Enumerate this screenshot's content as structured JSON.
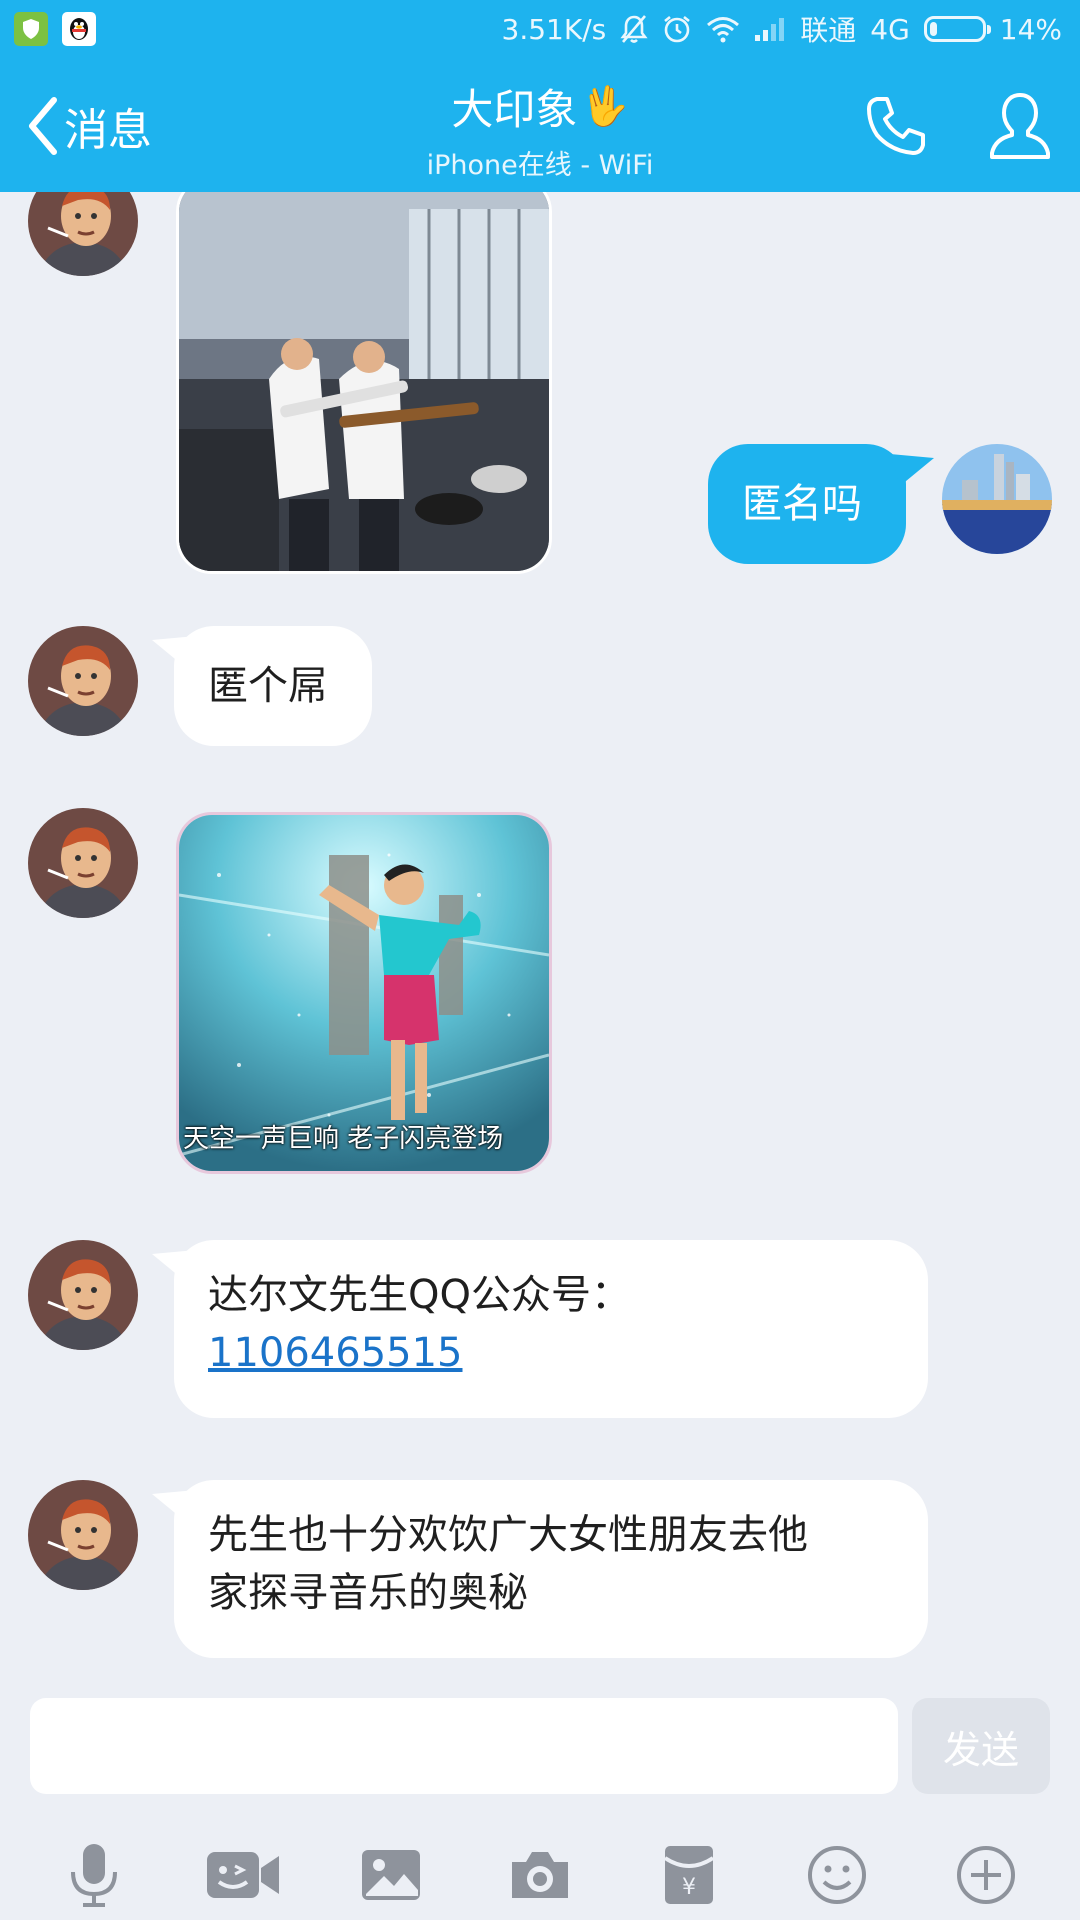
{
  "status_bar": {
    "network_speed": "3.51K/s",
    "carrier": "联通",
    "network_type": "4G",
    "battery": "14%",
    "battery_level": 0.14,
    "app_icons": [
      "shield-icon",
      "qq-penguin-icon"
    ],
    "status_icons": [
      "mute-bell-icon",
      "alarm-clock-icon",
      "wifi-icon",
      "signal-icon",
      "battery-icon"
    ]
  },
  "nav": {
    "back_label": "消息",
    "title": "大印象",
    "title_emoji": "🖖",
    "subtitle": "iPhone在线 - WiFi",
    "icons": [
      "back-chevron-icon",
      "phone-icon",
      "profile-icon"
    ]
  },
  "messages": [
    {
      "from": "other",
      "type": "image",
      "content": "photo of two students playing electric guitars in a band room"
    },
    {
      "from": "me",
      "type": "text",
      "text": "匿名吗"
    },
    {
      "from": "other",
      "type": "text",
      "text": "匿个屌"
    },
    {
      "from": "other",
      "type": "image",
      "caption": "天空一声巨响 老子闪亮登场"
    },
    {
      "from": "other",
      "type": "text",
      "text": "达尔文先生QQ公众号：",
      "link": "1106465515"
    },
    {
      "from": "other",
      "type": "text",
      "line1": "先生也十分欢饮广大女性朋友去他",
      "line2": "家探寻音乐的奥秘"
    }
  ],
  "input": {
    "value": "",
    "send_label": "发送"
  },
  "toolbar": {
    "icons": [
      "microphone-icon",
      "video-chat-icon",
      "image-icon",
      "camera-icon",
      "red-packet-icon",
      "emoji-icon",
      "plus-icon"
    ]
  },
  "colors": {
    "accent": "#1eb3ee",
    "background": "#eceff5",
    "bubble_other": "#ffffff",
    "bubble_mine": "#1eb3ee",
    "link": "#1a73c9",
    "icon_gray": "#8e939c"
  }
}
